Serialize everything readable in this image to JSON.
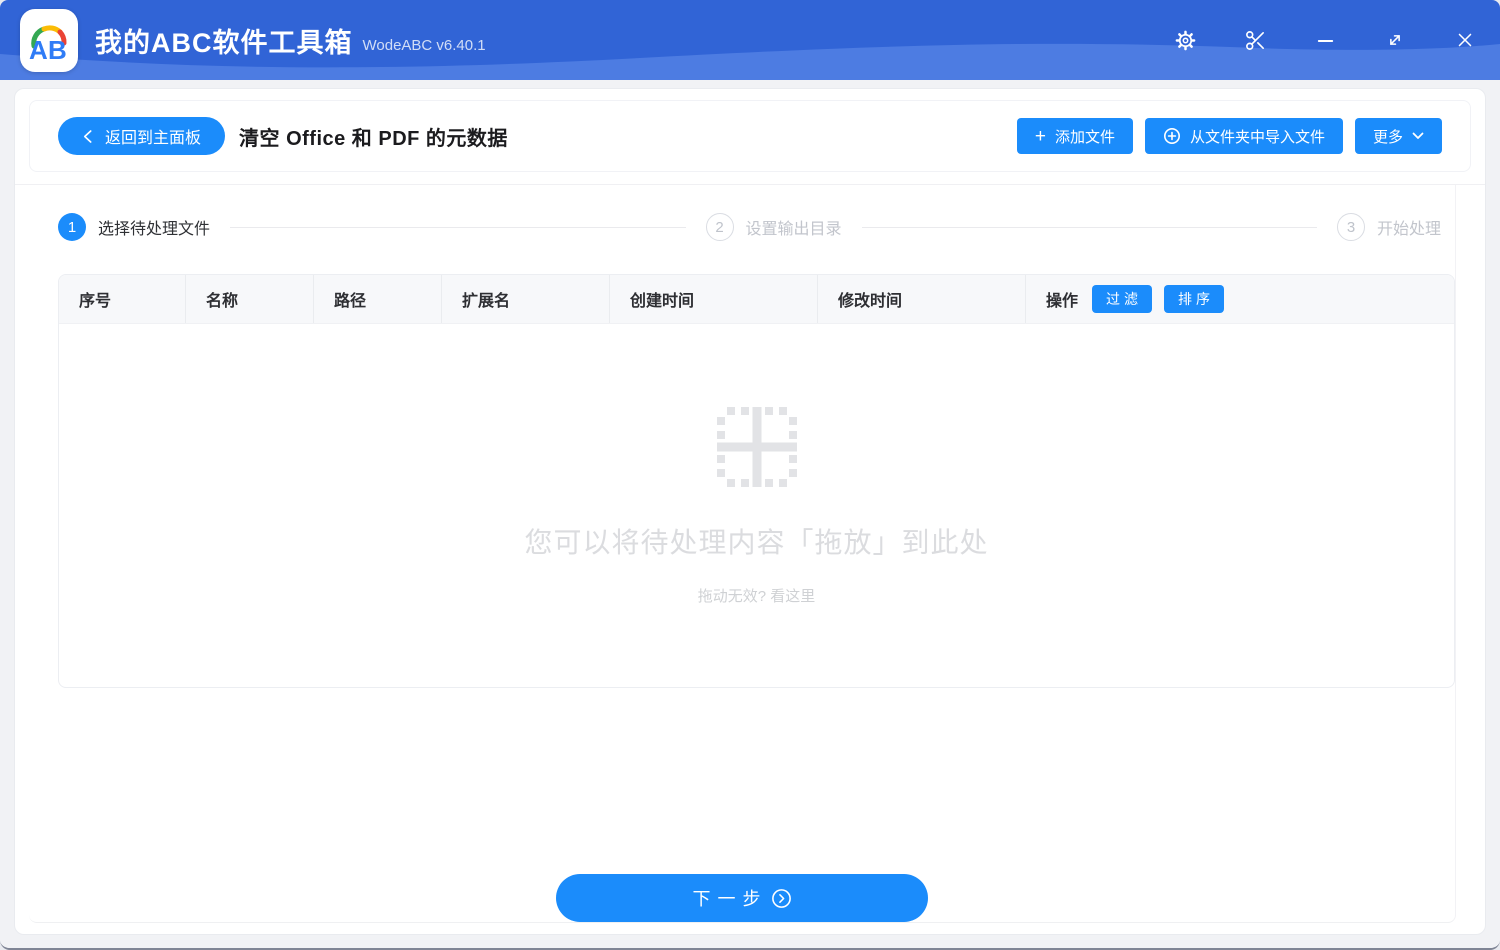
{
  "titlebar": {
    "app_title": "我的ABC软件工具箱",
    "version": "WodeABC v6.40.1",
    "logo_letter_a": "A",
    "logo_letter_b": "B"
  },
  "header": {
    "back_label": "返回到主面板",
    "page_title": "清空 Office 和 PDF 的元数据",
    "add_files_label": "添加文件",
    "import_folder_label": "从文件夹中导入文件",
    "more_label": "更多"
  },
  "steps": [
    {
      "num": "1",
      "label": "选择待处理文件"
    },
    {
      "num": "2",
      "label": "设置输出目录"
    },
    {
      "num": "3",
      "label": "开始处理"
    }
  ],
  "table": {
    "columns": [
      "序号",
      "名称",
      "路径",
      "扩展名",
      "创建时间",
      "修改时间",
      "操作"
    ],
    "filter_label": "过滤",
    "sort_label": "排序"
  },
  "empty_state": {
    "main_text": "您可以将待处理内容「拖放」到此处",
    "sub_text": "拖动无效? 看这里"
  },
  "footer": {
    "next_label": "下一步"
  },
  "colors": {
    "primary": "#1b8cfb",
    "titlebar_base": "#3164d6",
    "titlebar_wave": "#4d7ce2"
  }
}
